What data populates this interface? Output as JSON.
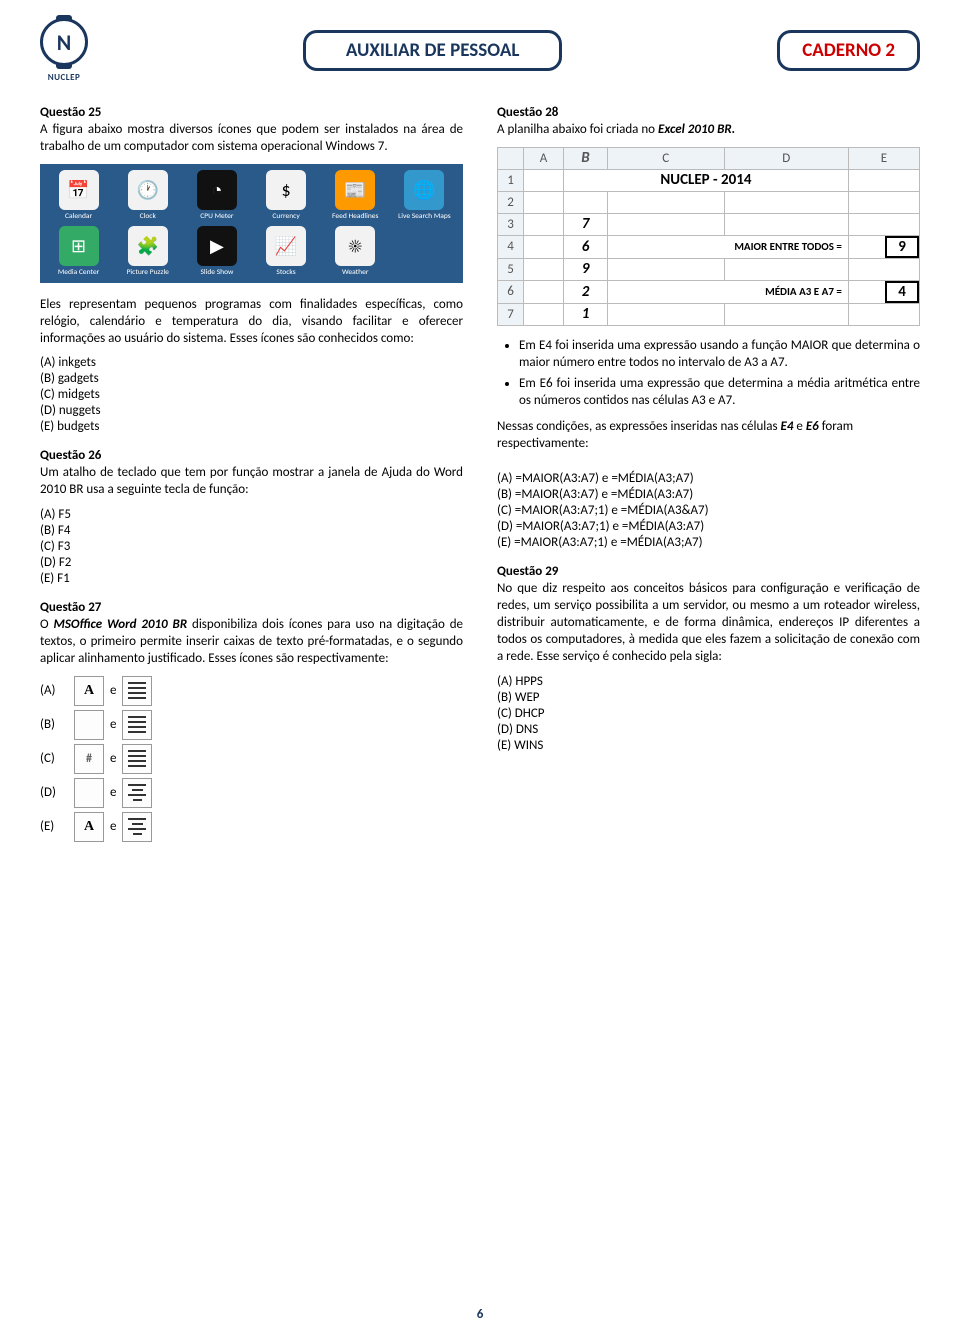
{
  "header": {
    "logo_letter": "N",
    "logo_label": "NUCLEP",
    "exam_title": "AUXILIAR DE PESSOAL",
    "booklet": "CADERNO 2"
  },
  "q25": {
    "title": "Questão 25",
    "text": "A figura abaixo mostra diversos ícones que podem ser instalados na área de trabalho de um computador com sistema operacional Windows 7.",
    "gadgets": [
      "Calendar",
      "Clock",
      "CPU Meter",
      "Currency",
      "Feed Headlines",
      "Live Search Maps",
      "Media Center",
      "Picture Puzzle",
      "Slide Show",
      "Stocks",
      "Weather"
    ],
    "gadget_glyphs": [
      "📅",
      "🕐",
      "◔",
      "$",
      "📰",
      "🌐",
      "⊞",
      "🧩",
      "▶",
      "📈",
      "☀"
    ],
    "text2": "Eles representam pequenos programas com finalidades específicas, como relógio, calendário e temperatura do dia, visando facilitar e oferecer informações ao usuário do sistema. Esses ícones são conhecidos como:",
    "options": [
      "(A) inkgets",
      "(B) gadgets",
      "(C) midgets",
      "(D) nuggets",
      "(E) budgets"
    ]
  },
  "q26": {
    "title": "Questão 26",
    "text": "Um atalho de teclado que tem por função mostrar a janela de Ajuda do Word 2010 BR usa a seguinte tecla de função:",
    "options": [
      "(A) F5",
      "(B) F4",
      "(C) F3",
      "(D) F2",
      "(E) F1"
    ]
  },
  "q27": {
    "title": "Questão 27",
    "text_pre": "O ",
    "text_bold": "MSOffice Word 2010 BR",
    "text_post": " disponibiliza dois ícones para uso na digitação de textos, o primeiro permite inserir caixas de texto pré-formatadas, e o segundo aplicar alinhamento justificado. Esses ícones são respectivamente:",
    "opts": [
      "(A)",
      "(B)",
      "(C)",
      "(D)",
      "(E)"
    ],
    "sep": "e"
  },
  "q28": {
    "title": "Questão 28",
    "text_pre": "A planilha abaixo foi criada no ",
    "text_bold": "Excel 2010 BR.",
    "sheet": {
      "cols": [
        "A",
        "B",
        "C",
        "D",
        "E"
      ],
      "title": "NUCLEP - 2014",
      "bvals": [
        "7",
        "6",
        "9",
        "2",
        "1"
      ],
      "label1": "MAIOR ENTRE TODOS =",
      "val1": "9",
      "label2": "MÉDIA A3 E A7 =",
      "val2": "4"
    },
    "bullets": [
      "Em E4 foi inserida uma expressão usando a função MAIOR que determina o maior número entre todos no intervalo de A3 a A7.",
      "Em E6 foi inserida uma expressão que determina a média aritmética entre os números contidos nas células A3 e A7."
    ],
    "text2_pre": "Nessas condições, as expressões inseridas nas células ",
    "text2_e4": "E4",
    "text2_mid": " e ",
    "text2_e6": "E6",
    "text2_post": " foram respectivamente:",
    "options": [
      "(A) =MAIOR(A3:A7) e =MÉDIA(A3;A7)",
      "(B) =MAIOR(A3:A7) e =MÉDIA(A3:A7)",
      "(C) =MAIOR(A3:A7;1) e =MÉDIA(A3&A7)",
      "(D) =MAIOR(A3:A7;1) e =MÉDIA(A3:A7)",
      "(E) =MAIOR(A3:A7;1) e =MÉDIA(A3;A7)"
    ]
  },
  "q29": {
    "title": "Questão 29",
    "text": "No que diz respeito aos conceitos básicos para configuração e verificação de redes, um serviço possibilita a um servidor, ou mesmo a um roteador wireless, distribuir automaticamente, e de forma dinâmica, endereços IP diferentes a todos os computadores, à medida que eles fazem a solicitação de conexão com a rede. Esse serviço é conhecido pela sigla:",
    "options": [
      "(A) HPPS",
      "(B) WEP",
      "(C) DHCP",
      "(D) DNS",
      "(E) WINS"
    ]
  },
  "page_number": "6"
}
